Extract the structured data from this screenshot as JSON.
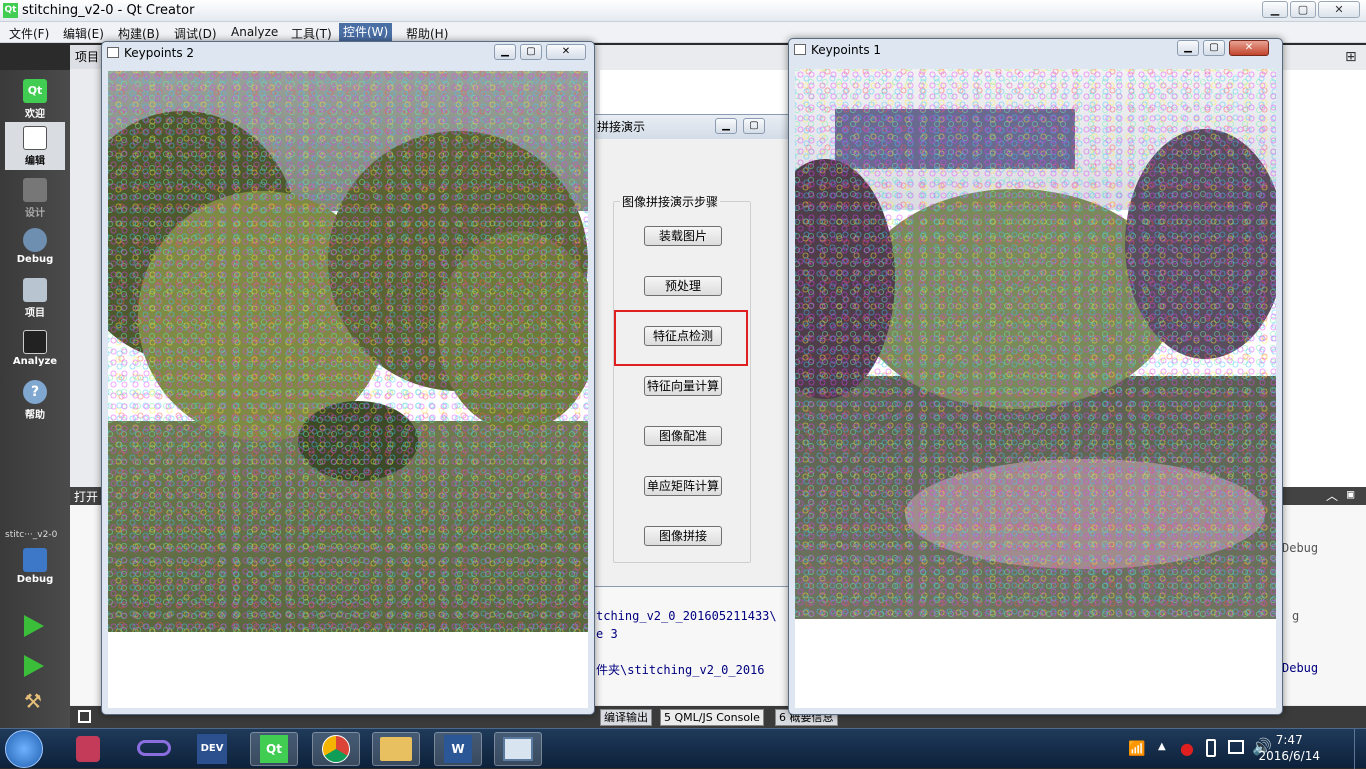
{
  "window": {
    "title": "stitching_v2-0 - Qt Creator",
    "logo": "Qt"
  },
  "menu": [
    "文件(F)",
    "编辑(E)",
    "构建(B)",
    "调试(D)",
    "Analyze",
    "工具(T)",
    "控件(W)",
    "帮助(H)"
  ],
  "modes": [
    {
      "label": "欢迎",
      "icon": "qt-logo-icon"
    },
    {
      "label": "编辑",
      "icon": "edit-document-icon"
    },
    {
      "label": "设计",
      "icon": "design-icon"
    },
    {
      "label": "Debug",
      "icon": "debug-icon"
    },
    {
      "label": "项目",
      "icon": "project-icon"
    },
    {
      "label": "Analyze",
      "icon": "analyze-icon"
    },
    {
      "label": "帮助",
      "icon": "help-icon"
    }
  ],
  "pane_labels": {
    "projects": "项目",
    "open_docs": "打开"
  },
  "target": {
    "project": "stitc···_v2-0",
    "config": "Debug"
  },
  "dialog": {
    "title": "拼接演示",
    "group_title": "图像拼接演示步骤",
    "buttons": [
      "装载图片",
      "预处理",
      "特征点检测",
      "特征向量计算",
      "图像配准",
      "单应矩阵计算",
      "图像拼接"
    ]
  },
  "keypoints2": {
    "title": "Keypoints 2"
  },
  "keypoints1": {
    "title": "Keypoints 1"
  },
  "output": {
    "lines": [
      "tching_v2_0_201605211433\\",
      "e 3",
      "件夹\\stitching_v2_0_2016"
    ],
    "right_lines": [
      "Debug",
      "g",
      "Debug"
    ]
  },
  "bottom_tabs": [
    {
      "num": "",
      "label": "编译输出"
    },
    {
      "num": "5",
      "label": "QML/JS Console"
    },
    {
      "num": "6",
      "label": "概要信息"
    }
  ],
  "taskbar": {
    "time": "7:47",
    "date": "2016/6/14"
  },
  "colors": {
    "highlight": "#e02020",
    "qt_green": "#41cd52",
    "active_menu": "#4a6fa5"
  }
}
